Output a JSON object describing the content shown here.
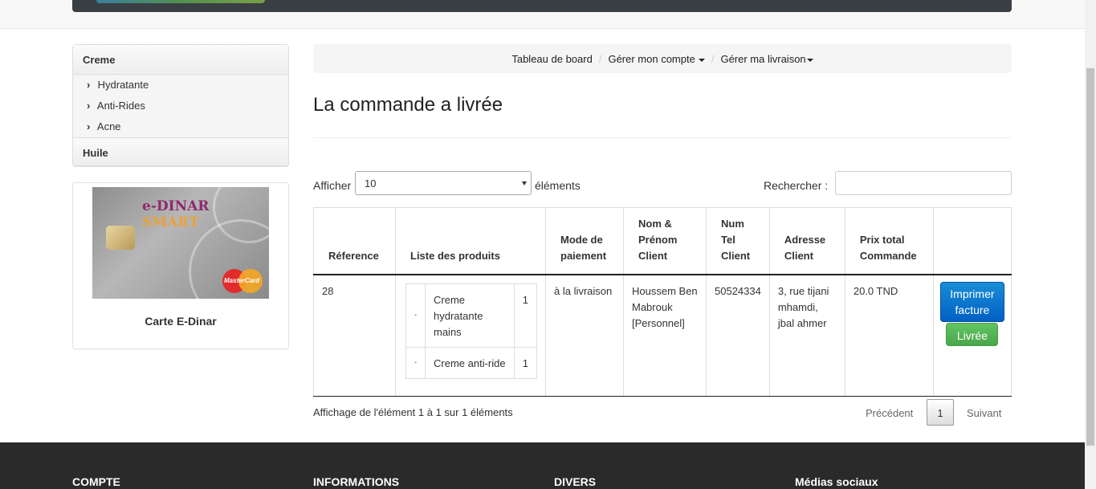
{
  "sidebar": {
    "categories": [
      {
        "title": "Creme",
        "items": [
          "Hydratante",
          "Anti-Rides",
          "Acne"
        ]
      },
      {
        "title": "Huile",
        "items": []
      }
    ],
    "card": {
      "brand_main": "e-DINAR",
      "brand_sub": "SMART",
      "mastercard": "MasterCard",
      "caption": "Carte E-Dinar"
    }
  },
  "breadcrumb": {
    "items": [
      "Tableau de board",
      "Gérer mon compte",
      "Gérer ma livraison"
    ]
  },
  "page": {
    "title": "La commande a livrée"
  },
  "controls": {
    "length_label": "Afficher",
    "length_value": "10",
    "length_after": "éléments",
    "search_label": "Rechercher :",
    "search_value": ""
  },
  "table": {
    "headers": [
      "Réference",
      "Liste des produits",
      "Mode de paiement",
      "Nom & Prénom Client",
      "Num Tel Client",
      "Adresse Client",
      "Prix total Commande",
      ""
    ],
    "rows": [
      {
        "reference": "28",
        "products": [
          {
            "name": "Creme hydratante mains",
            "qty": "1"
          },
          {
            "name": "Creme anti-ride",
            "qty": "1"
          }
        ],
        "payment": "à la livraison",
        "client": "Houssem Ben Mabrouk [Personnel]",
        "phone": "50524334",
        "address": "3, rue tijani mhamdi, jbal ahmer",
        "total": "20.0 TND",
        "print_label": "Imprimer facture",
        "delivered_label": "Livrée"
      }
    ]
  },
  "pagination": {
    "info": "Affichage de l'élément 1 à 1 sur 1 éléments",
    "prev": "Précédent",
    "current": "1",
    "next": "Suivant"
  },
  "footer": {
    "columns": [
      "COMPTE",
      "INFORMATIONS",
      "DIVERS",
      "Médias sociaux"
    ]
  }
}
